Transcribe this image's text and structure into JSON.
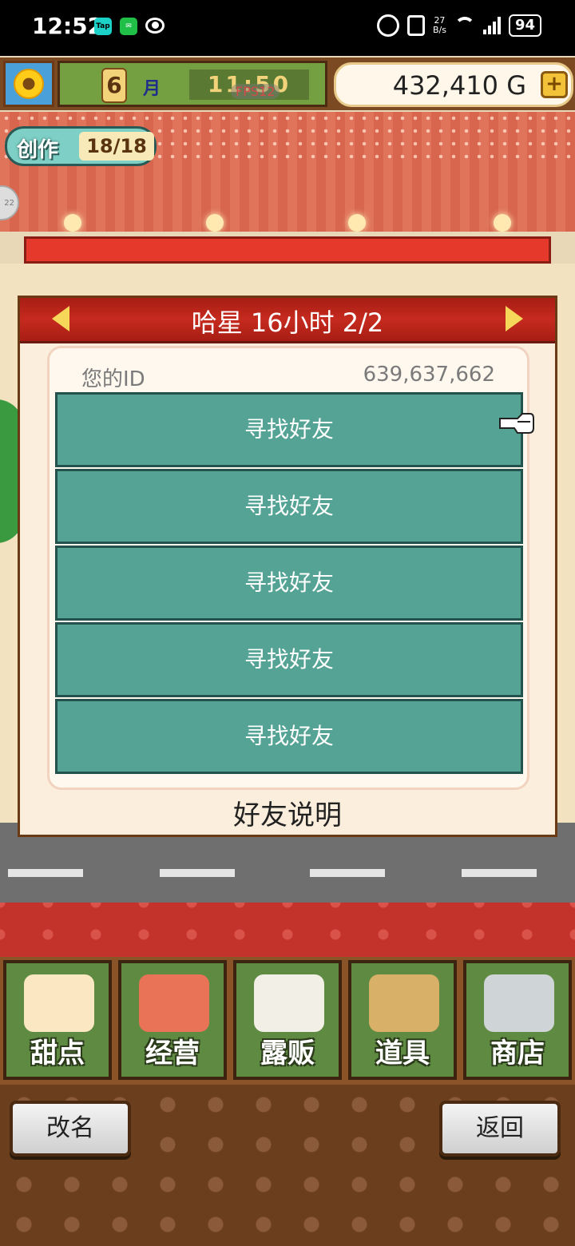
{
  "status_bar": {
    "time": "12:52",
    "left_icons": [
      "Tap",
      "wechat",
      "eye"
    ],
    "net_speed_value": "27",
    "net_speed_unit": "B/s",
    "battery": "94"
  },
  "hud": {
    "month": "6",
    "month_label": "月",
    "clock": "11:50",
    "fps": "FPS12",
    "money": "432,410 G",
    "craft_label": "创作",
    "craft_count": "18/18",
    "side_bubble": "22"
  },
  "dialog": {
    "title": "哈星  16小时 2/2",
    "id_label": "您的ID",
    "id_value": "639,637,662",
    "friend_buttons": [
      "寻找好友",
      "寻找好友",
      "寻找好友",
      "寻找好友",
      "寻找好友"
    ],
    "help_label": "好友说明"
  },
  "menu": [
    "甜点",
    "经营",
    "露贩",
    "道具",
    "商店"
  ],
  "footer": {
    "rename_label": "改名",
    "back_label": "返回"
  },
  "colors": {
    "friend_button": "#54a395",
    "dialog_header": "#c62a1e",
    "menu_tile": "#5f8a42"
  }
}
